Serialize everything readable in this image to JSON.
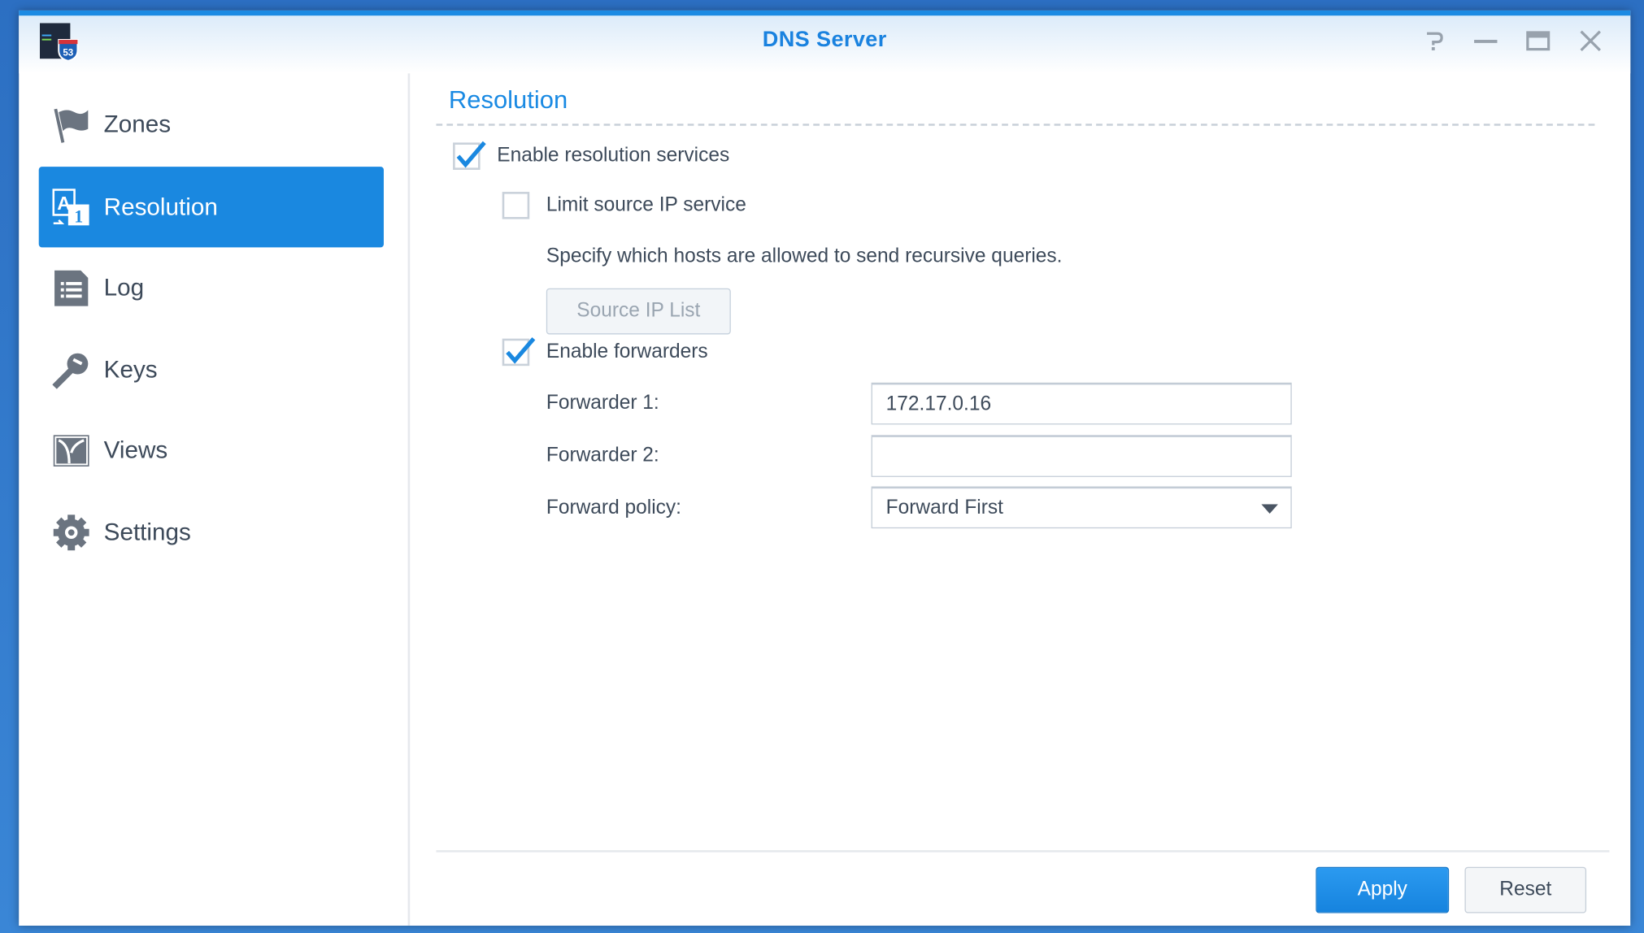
{
  "window": {
    "title": "DNS Server",
    "app_icon_badge": "53",
    "controls": [
      "help-icon",
      "minimize-icon",
      "maximize-icon",
      "close-icon"
    ]
  },
  "sidebar": {
    "items": [
      {
        "label": "Zones",
        "icon": "flag-icon",
        "active": false
      },
      {
        "label": "Resolution",
        "icon": "resolution-icon",
        "active": true
      },
      {
        "label": "Log",
        "icon": "log-icon",
        "active": false
      },
      {
        "label": "Keys",
        "icon": "key-icon",
        "active": false
      },
      {
        "label": "Views",
        "icon": "views-icon",
        "active": false
      },
      {
        "label": "Settings",
        "icon": "gear-icon",
        "active": false
      }
    ]
  },
  "main": {
    "section_title": "Resolution",
    "enable_resolution": {
      "label": "Enable resolution services",
      "checked": true
    },
    "limit_source_ip": {
      "label": "Limit source IP service",
      "checked": false
    },
    "limit_description": "Specify which hosts are allowed to send recursive queries.",
    "source_ip_list_button": "Source IP List",
    "enable_forwarders": {
      "label": "Enable forwarders",
      "checked": true
    },
    "forwarder1": {
      "label": "Forwarder 1:",
      "value": "172.17.0.16"
    },
    "forwarder2": {
      "label": "Forwarder 2:",
      "value": ""
    },
    "forward_policy": {
      "label": "Forward policy:",
      "value": "Forward First"
    }
  },
  "footer": {
    "apply": "Apply",
    "reset": "Reset"
  },
  "colors": {
    "accent": "#1a88e0",
    "text": "#3d4a5a"
  }
}
